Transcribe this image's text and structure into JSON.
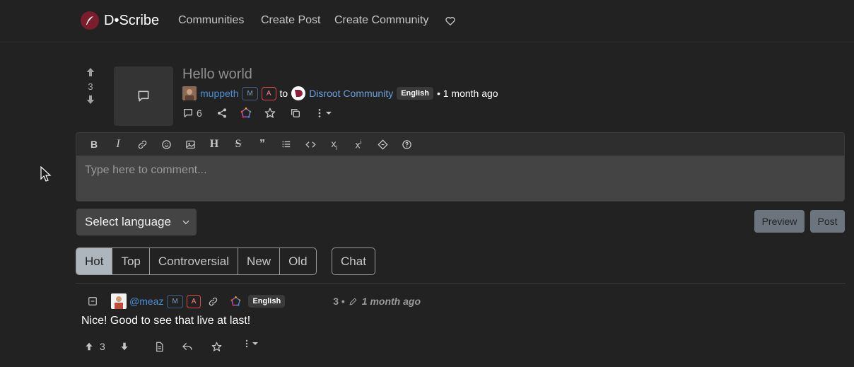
{
  "nav": {
    "brand": "D•Scribe",
    "links": [
      "Communities",
      "Create Post",
      "Create Community"
    ],
    "donate_icon": "heart-icon"
  },
  "post": {
    "score": "3",
    "title": "Hello world",
    "author": "muppeth",
    "badge_mod": "M",
    "badge_admin": "A",
    "to": "to",
    "community": "Disroot Community",
    "language": "English",
    "time": "• 1 month ago",
    "comment_count": "6"
  },
  "editor": {
    "placeholder": "Type here to comment...",
    "tools": [
      "bold",
      "italic",
      "link",
      "emoji",
      "image",
      "header",
      "strikethrough",
      "quote",
      "list",
      "code",
      "subscript",
      "superscript",
      "spoiler",
      "help"
    ]
  },
  "form": {
    "language_select": "Select language",
    "preview": "Preview",
    "post": "Post"
  },
  "sort": {
    "options": [
      "Hot",
      "Top",
      "Controversial",
      "New",
      "Old"
    ],
    "active": "Hot",
    "chat": "Chat"
  },
  "comment": {
    "author": "@meaz",
    "badge_mod": "M",
    "badge_admin": "A",
    "language": "English",
    "score": "3 •",
    "time": "1 month ago",
    "text": "Nice! Good to see that live at last!",
    "upvotes": "3"
  },
  "colors": {
    "background": "#222222",
    "link": "#4a8fd8",
    "brand": "#7a1d2d",
    "admin_badge": "#e04848"
  }
}
